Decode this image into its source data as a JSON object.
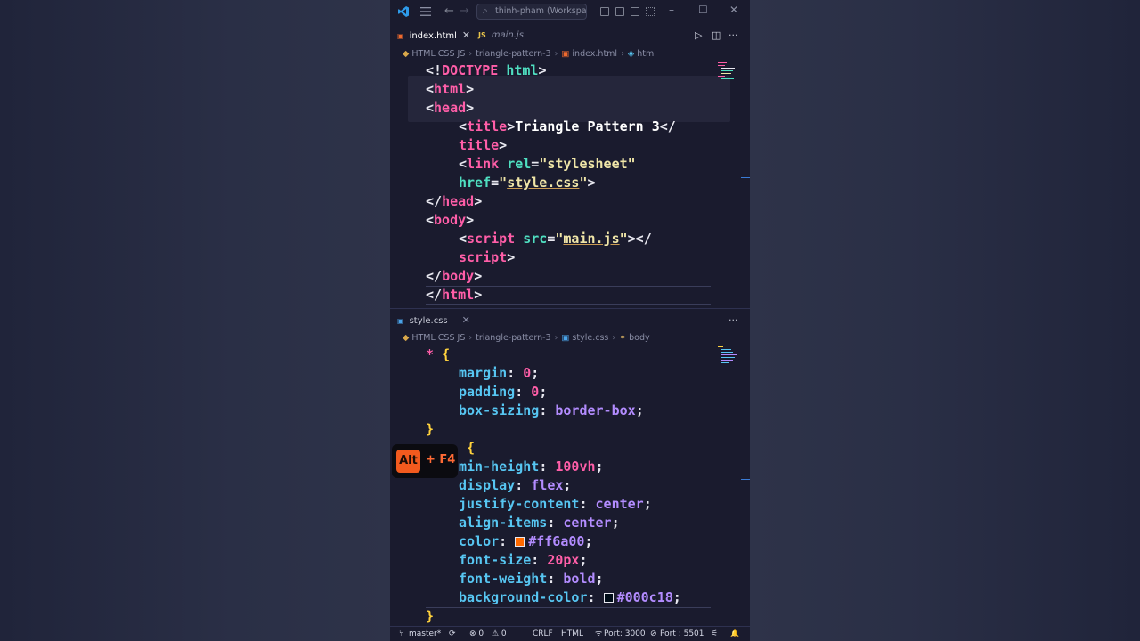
{
  "titlebar": {
    "search_text": "thinh-pham (Workspace)",
    "icons": [
      "vscode-logo-icon",
      "menu-icon",
      "back-arrow-icon",
      "forward-arrow-icon",
      "search-icon",
      "toggle-sidebar-icon",
      "toggle-panel-icon",
      "toggle-secondary-sidebar-icon",
      "customize-layout-icon",
      "minimize-icon",
      "maximize-icon",
      "close-icon"
    ],
    "glyphs": {
      "back": "←",
      "forward": "→",
      "minimize": "–",
      "maximize": "☐",
      "close": "✕"
    }
  },
  "top_pane": {
    "tabs": [
      {
        "label": "index.html",
        "icon": "html-file-icon",
        "active": true
      },
      {
        "label": "main.js",
        "icon_text": "JS",
        "active": false
      }
    ],
    "tab_close_glyph": "✕",
    "run_glyph": "▷",
    "split_glyph": "◫",
    "more_glyph": "···",
    "breadcrumbs": [
      "HTML CSS JS",
      "triangle-pattern-3",
      "index.html",
      "html"
    ]
  },
  "bottom_pane": {
    "tabs": [
      {
        "label": "style.css",
        "icon": "css-file-icon",
        "active": false
      }
    ],
    "more_glyph": "···",
    "breadcrumbs": [
      "HTML CSS JS",
      "triangle-pattern-3",
      "style.css",
      "body"
    ]
  },
  "breadcrumb_sep": "›",
  "html_code": {
    "l1": {
      "p1": "<!",
      "kw": "DOCTYPE",
      "sp": " ",
      "w": "html",
      "p2": ">"
    },
    "l2": {
      "p1": "<",
      "t": "html",
      "p2": ">"
    },
    "l3": {
      "p1": "<",
      "t": "head",
      "p2": ">"
    },
    "l4": {
      "p1": "<",
      "t": "title",
      "p2": ">",
      "text": "Triangle Pattern 3",
      "p3": "</"
    },
    "l5": {
      "t": "title",
      "p2": ">"
    },
    "l6": {
      "p1": "<",
      "t": "link",
      "sp": " ",
      "a": "rel",
      "eq": "=",
      "q1": "\"",
      "s": "stylesheet",
      "q2": "\""
    },
    "l7": {
      "a": "href",
      "eq": "=",
      "q1": "\"",
      "s": "style.css",
      "q2": "\"",
      "p2": ">"
    },
    "l8": {
      "p1": "</",
      "t": "head",
      "p2": ">"
    },
    "l9": {
      "p1": "<",
      "t": "body",
      "p2": ">"
    },
    "l10": {
      "p1": "<",
      "t": "script",
      "sp": " ",
      "a": "src",
      "eq": "=",
      "q1": "\"",
      "s": "main.js",
      "q2": "\"",
      "p2": "></"
    },
    "l11": {
      "t": "script",
      "p2": ">"
    },
    "l12": {
      "p1": "</",
      "t": "body",
      "p2": ">"
    },
    "l13": {
      "p1": "</",
      "t": "html",
      "p2": ">"
    }
  },
  "css_code": {
    "c1": {
      "sel": "*",
      "sp": " ",
      "b": "{"
    },
    "c2": {
      "prop": "margin",
      "colon": ": ",
      "v": "0",
      "semi": ";"
    },
    "c3": {
      "prop": "padding",
      "colon": ": ",
      "v": "0",
      "semi": ";"
    },
    "c4": {
      "prop": "box-sizing",
      "colon": ": ",
      "v": "border-box",
      "semi": ";"
    },
    "c5": {
      "b": "}"
    },
    "c6": {
      "b": "{"
    },
    "c7": {
      "prop": "min-height",
      "colon": ": ",
      "v": "100vh",
      "semi": ";"
    },
    "c8": {
      "prop": "display",
      "colon": ": ",
      "v": "flex",
      "semi": ";"
    },
    "c9": {
      "prop": "justify-content",
      "colon": ": ",
      "v": "center",
      "semi": ";"
    },
    "c10": {
      "prop": "align-items",
      "colon": ": ",
      "v": "center",
      "semi": ";"
    },
    "c11": {
      "prop": "color",
      "colon": ": ",
      "v": "#ff6a00",
      "semi": ";",
      "swatch": "#ff6a00"
    },
    "c12": {
      "prop": "font-size",
      "colon": ": ",
      "v": "20px",
      "semi": ";"
    },
    "c13": {
      "prop": "font-weight",
      "colon": ": ",
      "v": "bold",
      "semi": ";"
    },
    "c14": {
      "prop": "background-color",
      "colon": ": ",
      "v": "#000c18",
      "semi": ";",
      "swatch": "#000c18"
    },
    "c15": {
      "b": "}"
    }
  },
  "overlay": {
    "key": "Alt",
    "combo": "+ F4"
  },
  "statusbar": {
    "branch": "master*",
    "sync_glyph": "⟳",
    "errors": "⊗ 0",
    "warnings": "⚠ 0",
    "eol": "CRLF",
    "language": "HTML",
    "port1": "Port: 3000",
    "port2": "Port : 5501",
    "port2_glyph": "⊘",
    "broadcast_glyph": "⚟",
    "bell_glyph": "🔔"
  },
  "colors": {
    "editor_bg": "#1a1b2e",
    "tag": "#ff5ea8",
    "attr": "#4fdfc1",
    "property": "#57c6f2",
    "value": "#b38cff",
    "brace": "#ffd23d",
    "accent": "#f25a1e"
  }
}
